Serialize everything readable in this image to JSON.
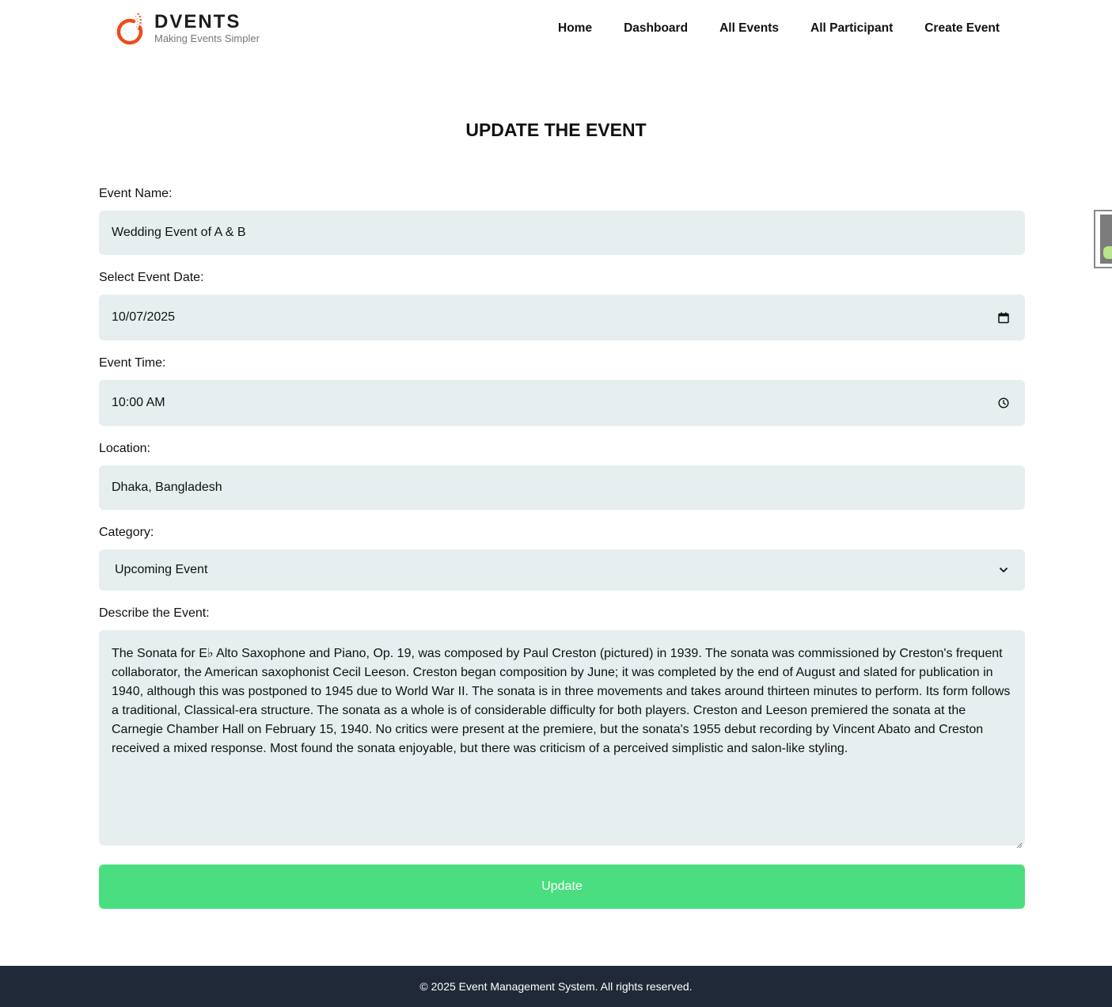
{
  "brand": {
    "name": "DVENTS",
    "tagline": "Making Events Simpler",
    "logo_icon": "sparkle-ring-logo",
    "accent": "#f04a1a"
  },
  "nav": {
    "items": [
      {
        "label": "Home"
      },
      {
        "label": "Dashboard"
      },
      {
        "label": "All Events"
      },
      {
        "label": "All Participant"
      },
      {
        "label": "Create Event"
      }
    ]
  },
  "page": {
    "title": "UPDATE THE EVENT"
  },
  "form": {
    "event_name": {
      "label": "Event Name:",
      "value": "Wedding Event of A & B"
    },
    "event_date": {
      "label": "Select Event Date:",
      "value": "10/07/2025",
      "icon": "calendar-icon"
    },
    "event_time": {
      "label": "Event Time:",
      "value": "10:00 AM",
      "icon": "clock-icon"
    },
    "location": {
      "label": "Location:",
      "value": "Dhaka, Bangladesh"
    },
    "category": {
      "label": "Category:",
      "value": "Upcoming Event",
      "icon": "chevron-down-icon"
    },
    "description": {
      "label": "Describe the Event:",
      "value": "The Sonata for E♭ Alto Saxophone and Piano, Op. 19, was composed by Paul Creston (pictured) in 1939. The sonata was commissioned by Creston's frequent collaborator, the American saxophonist Cecil Leeson. Creston began composition by June; it was completed by the end of August and slated for publication in 1940, although this was postponed to 1945 due to World War II. The sonata is in three movements and takes around thirteen minutes to perform. Its form follows a traditional, Classical-era structure. The sonata as a whole is of considerable difficulty for both players. Creston and Leeson premiered the sonata at the Carnegie Chamber Hall on February 15, 1940. No critics were present at the premiere, but the sonata's 1955 debut recording by Vincent Abato and Creston received a mixed response. Most found the sonata enjoyable, but there was criticism of a perceived simplistic and salon-like styling."
    },
    "submit_label": "Update",
    "submit_color": "#4ade80",
    "field_bg": "#e6eeef"
  },
  "footer": {
    "text": "© 2025 Event Management System. All rights reserved.",
    "bg": "#1f2937"
  }
}
